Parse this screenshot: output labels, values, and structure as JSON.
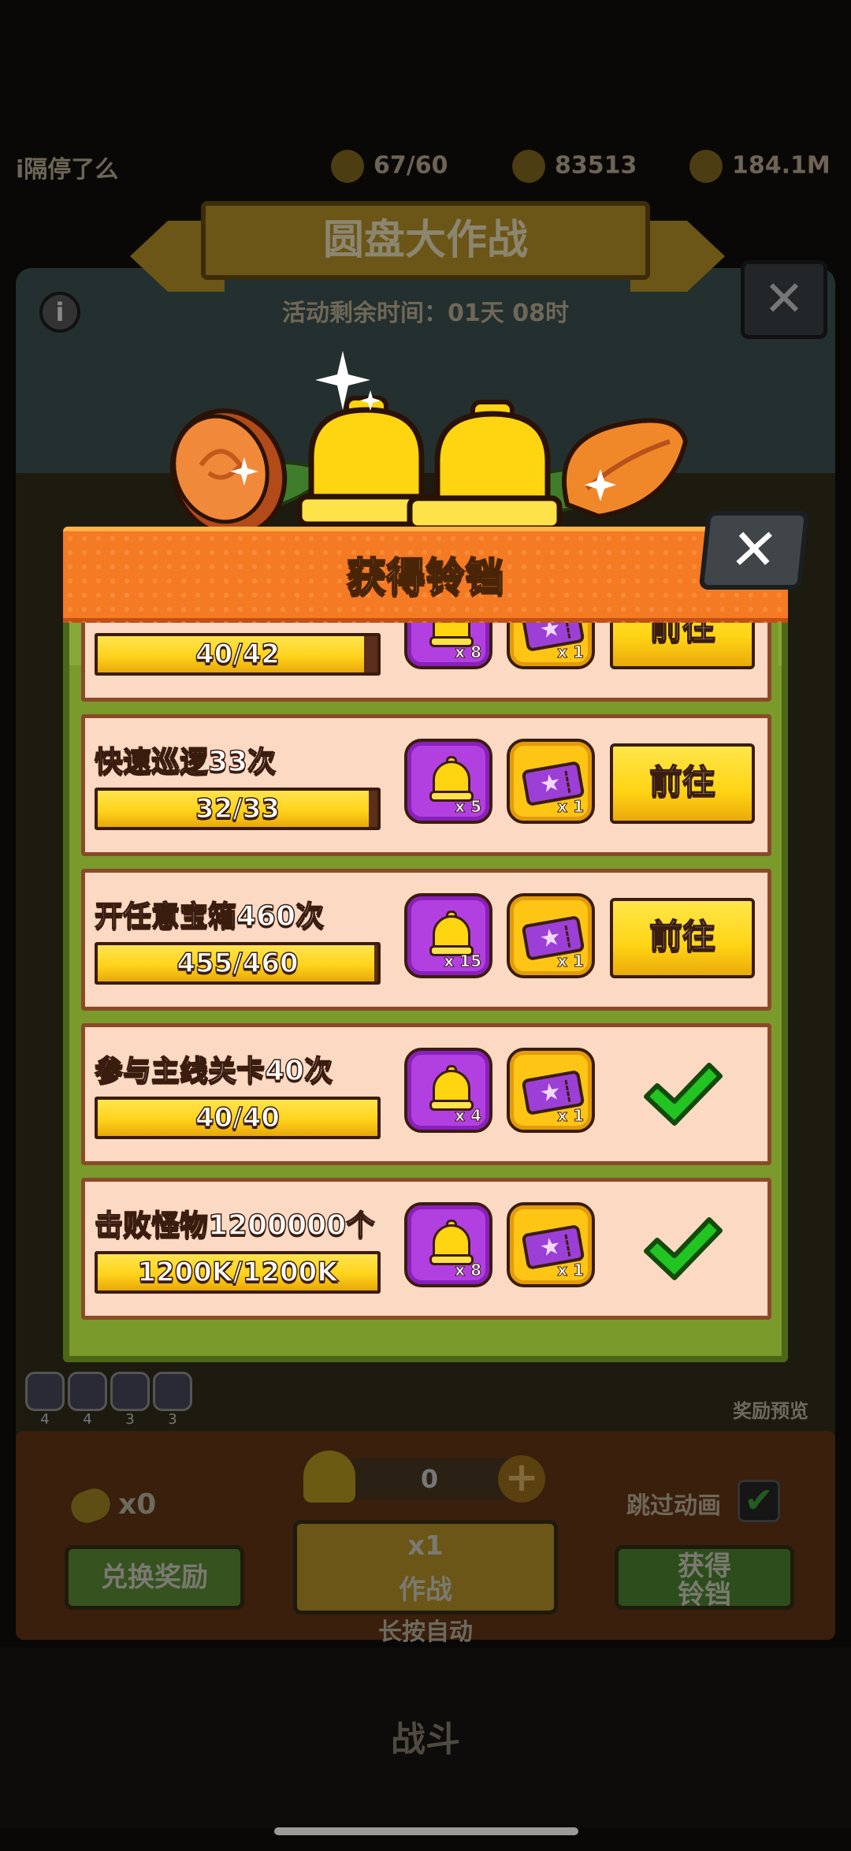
{
  "background": {
    "player_name": "i隔停了么",
    "resources": [
      {
        "icon": "energy-icon",
        "value": "67/60"
      },
      {
        "icon": "gem-icon",
        "value": "83513"
      },
      {
        "icon": "gold-coin-icon",
        "value": "184.1M"
      }
    ],
    "event_title": "圆盘大作战",
    "event_timer": "活动剩余时间：01天 08时",
    "mini_counts": [
      "4",
      "4",
      "3",
      "3"
    ],
    "reward_preview_label": "奖励预览",
    "corn_count": "x0",
    "bell_balance": "0",
    "skip_animation_label": "跳过动画",
    "exchange_button": "兑换奖励",
    "battle_multiplier": "x1",
    "battle_button": "作战",
    "obtain_button_line1": "获得",
    "obtain_button_line2": "铃铛",
    "long_press_label": "长按自动",
    "nav_battle_label": "战斗"
  },
  "dialog": {
    "title": "获得铃铛",
    "close_icon": "close-x-icon",
    "tasks": [
      {
        "name": "",
        "progress_text": "40/42",
        "progress": 0.952,
        "bell_count": "x 8",
        "ticket_count": "x 1",
        "action": "前往",
        "completed": false
      },
      {
        "name": "快速巡逻33次",
        "progress_text": "32/33",
        "progress": 0.97,
        "bell_count": "x 5",
        "ticket_count": "x 1",
        "action": "前往",
        "completed": false
      },
      {
        "name": "开任意宝箱460次",
        "progress_text": "455/460",
        "progress": 0.989,
        "bell_count": "x 15",
        "ticket_count": "x 1",
        "action": "前往",
        "completed": false
      },
      {
        "name": "参与主线关卡40次",
        "progress_text": "40/40",
        "progress": 1.0,
        "bell_count": "x 4",
        "ticket_count": "x 1",
        "action": "",
        "completed": true
      },
      {
        "name": "击败怪物1200000个",
        "progress_text": "1200K/1200K",
        "progress": 1.0,
        "bell_count": "x 8",
        "ticket_count": "x 1",
        "action": "",
        "completed": true
      }
    ]
  },
  "colors": {
    "header_orange": "#f47a23",
    "body_green": "#7a9a2c",
    "card_peach": "#fcd9c3",
    "bell_purple": "#b240e0",
    "ticket_gold": "#ffc515",
    "check_green": "#22c422"
  }
}
